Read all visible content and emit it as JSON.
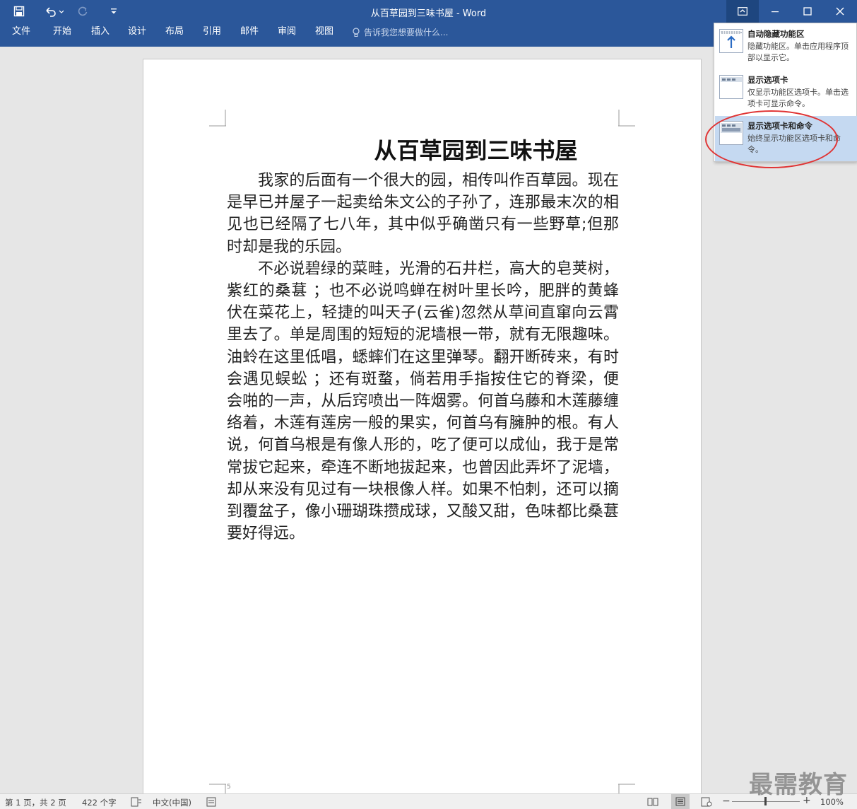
{
  "window": {
    "title": "从百草园到三味书屋 - Word"
  },
  "ribbon_tabs": [
    {
      "label": "文件"
    },
    {
      "label": "开始"
    },
    {
      "label": "插入"
    },
    {
      "label": "设计"
    },
    {
      "label": "布局"
    },
    {
      "label": "引用"
    },
    {
      "label": "邮件"
    },
    {
      "label": "审阅"
    },
    {
      "label": "视图"
    }
  ],
  "tell_me": {
    "label": "告诉我您想要做什么..."
  },
  "ribbon_display_menu": {
    "items": [
      {
        "title": "自动隐藏功能区",
        "desc": "隐藏功能区。单击应用程序顶部以显示它。",
        "icon": "auto-hide-ribbon-icon",
        "selected": false
      },
      {
        "title": "显示选项卡",
        "desc": "仅显示功能区选项卡。单击选项卡可显示命令。",
        "icon": "show-tabs-icon",
        "selected": false
      },
      {
        "title": "显示选项卡和命令",
        "desc": "始终显示功能区选项卡和命令。",
        "icon": "show-tabs-and-commands-icon",
        "selected": true
      }
    ]
  },
  "document": {
    "title": "从百草园到三味书屋",
    "paragraphs": [
      "我家的后面有一个很大的园，相传叫作百草园。现在是早已并屋子一起卖给朱文公的子孙了，连那最末次的相见也已经隔了七八年，其中似乎确凿只有一些野草;但那时却是我的乐园。",
      "不必说碧绿的菜畦，光滑的石井栏，高大的皂荚树，紫红的桑葚 ；也不必说鸣蝉在树叶里长吟，肥胖的黄蜂伏在菜花上，轻捷的叫天子(云雀)忽然从草间直窜向云霄里去了。单是周围的短短的泥墙根一带，就有无限趣味。油蛉在这里低唱，蟋蟀们在这里弹琴。翻开断砖来，有时会遇见蜈蚣 ；还有斑蝥，倘若用手指按住它的脊梁，便会啪的一声，从后窍喷出一阵烟雾。何首乌藤和木莲藤缠络着，木莲有莲房一般的果实，何首乌有臃肿的根。有人说，何首乌根是有像人形的，吃了便可以成仙，我于是常常拔它起来，牵连不断地拔起来，也曾因此弄坏了泥墙，却从来没有见过有一块根像人样。如果不怕刺，还可以摘到覆盆子，像小珊瑚珠攒成球，又酸又甜，色味都比桑葚要好得远。"
    ],
    "page_marker": "5"
  },
  "status_bar": {
    "page": "第 1 页，共 2 页",
    "word_count": "422 个字",
    "language": "中文(中国)",
    "zoom": "100%"
  },
  "watermark": "最需教育",
  "colors": {
    "accent": "#2b579a",
    "menu_selected": "#c5d9f1",
    "annotation": "#e03434"
  }
}
